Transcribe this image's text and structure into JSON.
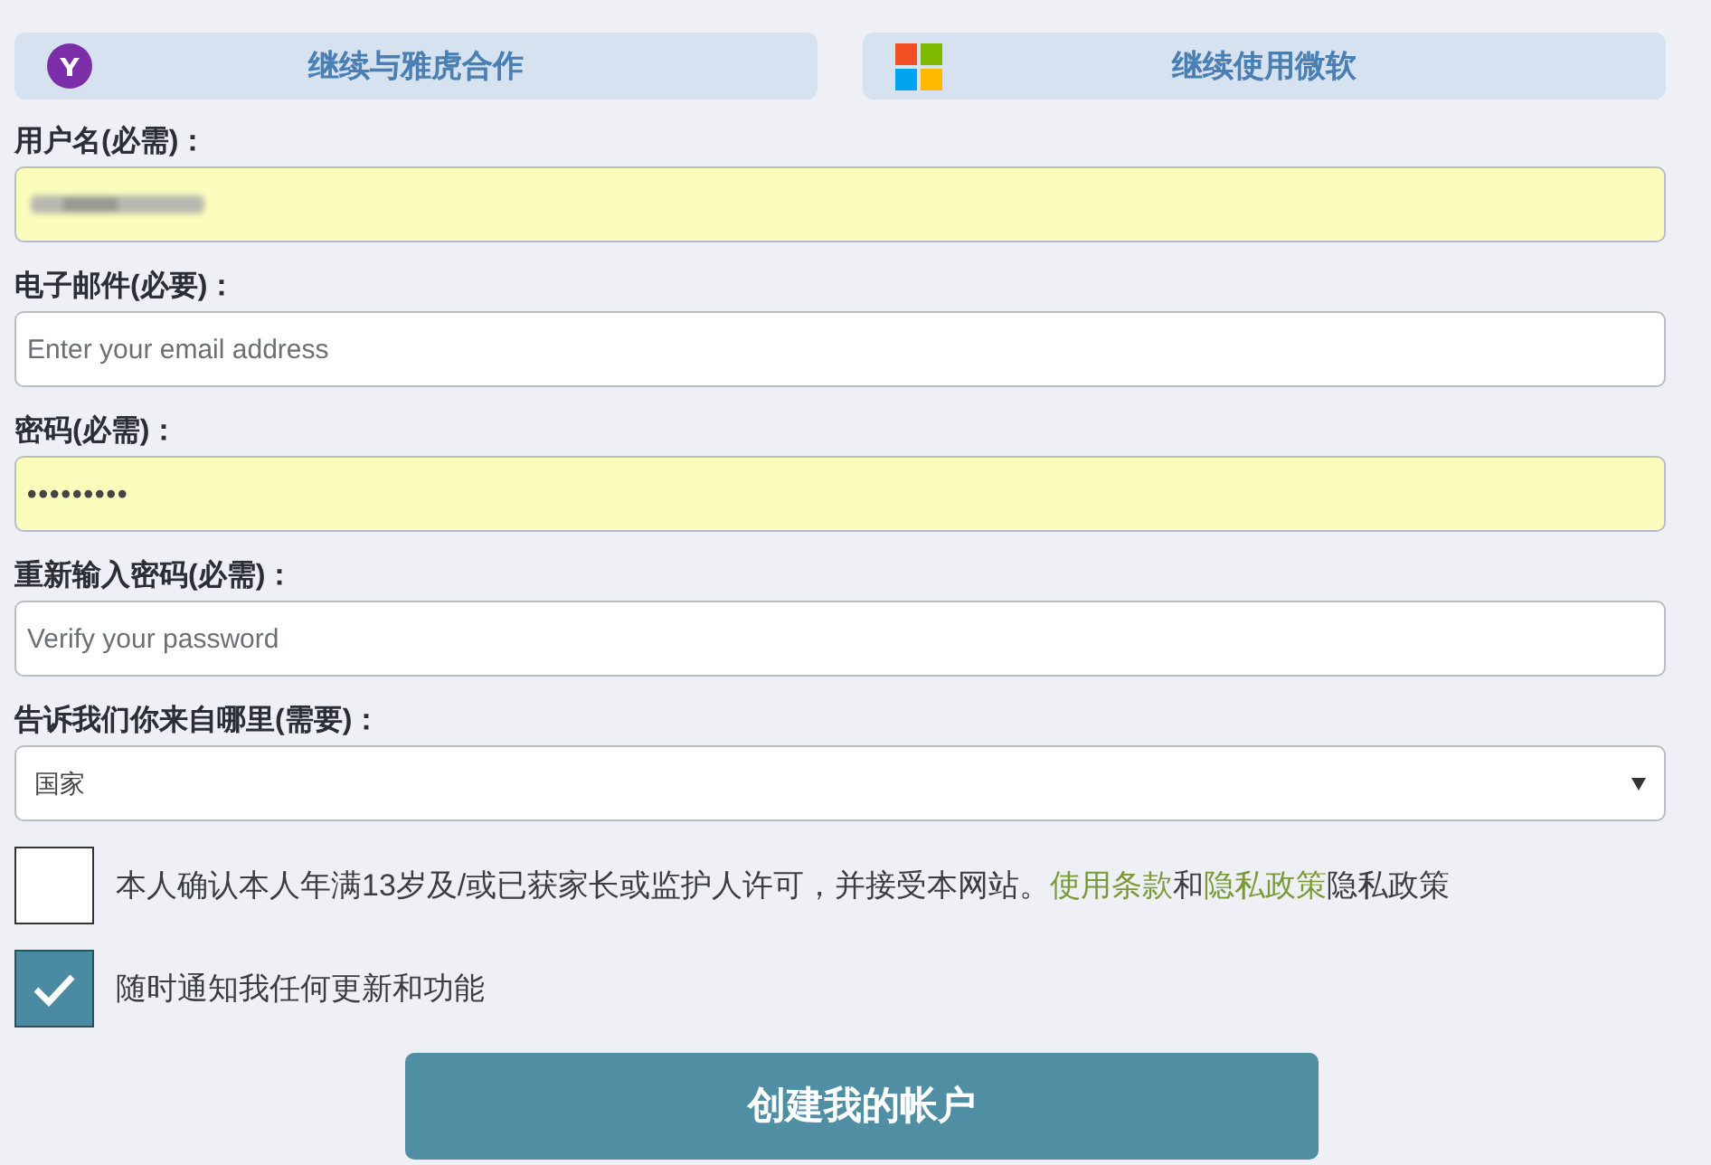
{
  "social_buttons": [
    {
      "kind": "yahoo",
      "label": "继续与雅虎合作"
    },
    {
      "kind": "microsoft",
      "label": "继续使用微软"
    }
  ],
  "fields": [
    {
      "kind": "text",
      "label": "用户名(必需)：",
      "autofilled": true,
      "blurred": true
    },
    {
      "kind": "text",
      "label": "电子邮件(必要)：",
      "autofilled": false,
      "placeholder": "Enter your email address"
    },
    {
      "kind": "password",
      "label": "密码(必需)：",
      "autofilled": true,
      "value": "•••••••••"
    },
    {
      "kind": "password",
      "label": "重新输入密码(必需)：",
      "autofilled": false,
      "placeholder": "Verify your password"
    },
    {
      "kind": "select",
      "label": "告诉我们你来自哪里(需要)：",
      "autofilled": false,
      "value": "国家"
    }
  ],
  "checkboxes": [
    {
      "checked": false,
      "parts": [
        {
          "kind": "text",
          "text": "本人确认本人年满13岁及/或已获家长或监护人许可，并接受本网站。"
        },
        {
          "kind": "link",
          "text": "使用条款"
        },
        {
          "kind": "text",
          "text": "和"
        },
        {
          "kind": "link",
          "text": "隐私政策"
        },
        {
          "kind": "text",
          "text": "隐私政策"
        }
      ]
    },
    {
      "checked": true,
      "parts": [
        {
          "kind": "text",
          "text": "随时通知我任何更新和功能"
        }
      ]
    }
  ],
  "submit_button": "创建我的帐户"
}
